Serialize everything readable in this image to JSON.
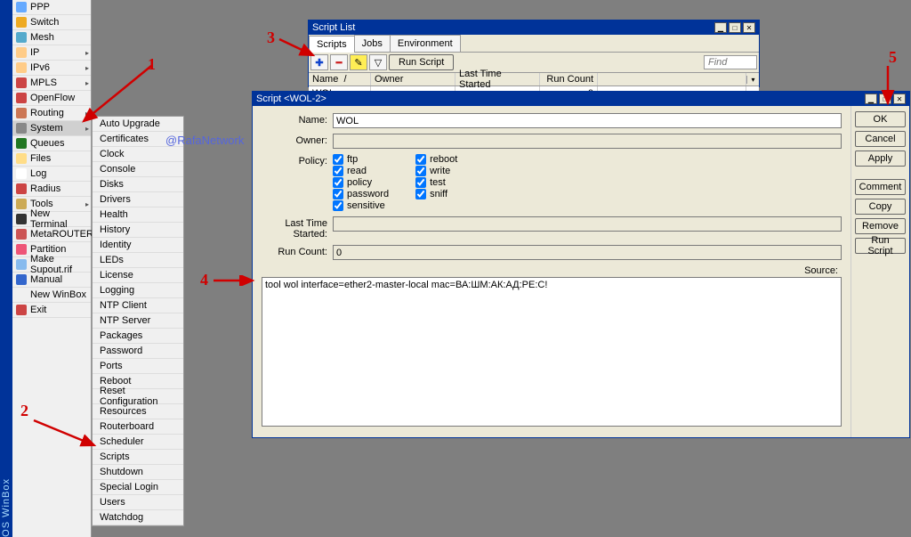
{
  "app": {
    "vertical_label": "OS  WinBox"
  },
  "watermark": "@RafaNetwork",
  "annotations": {
    "n1": "1",
    "n2": "2",
    "n3": "3",
    "n4": "4",
    "n5": "5"
  },
  "menu": [
    {
      "label": "PPP",
      "icon": "#66aaff",
      "arrow": false
    },
    {
      "label": "Switch",
      "icon": "#eeaa22",
      "arrow": false
    },
    {
      "label": "Mesh",
      "icon": "#55aacc",
      "arrow": false
    },
    {
      "label": "IP",
      "icon": "#ffcc88",
      "arrow": true
    },
    {
      "label": "IPv6",
      "icon": "#ffcc88",
      "arrow": true
    },
    {
      "label": "MPLS",
      "icon": "#cc4444",
      "arrow": true
    },
    {
      "label": "OpenFlow",
      "icon": "#cc4444",
      "arrow": false
    },
    {
      "label": "Routing",
      "icon": "#cc7755",
      "arrow": true
    },
    {
      "label": "System",
      "icon": "#888888",
      "arrow": true,
      "selected": true
    },
    {
      "label": "Queues",
      "icon": "#227722",
      "arrow": false
    },
    {
      "label": "Files",
      "icon": "#ffdd88",
      "arrow": false
    },
    {
      "label": "Log",
      "icon": "#ffffff",
      "arrow": false
    },
    {
      "label": "Radius",
      "icon": "#cc4444",
      "arrow": false
    },
    {
      "label": "Tools",
      "icon": "#ccaa55",
      "arrow": true
    },
    {
      "label": "New Terminal",
      "icon": "#333333",
      "arrow": false
    },
    {
      "label": "MetaROUTER",
      "icon": "#cc5555",
      "arrow": false
    },
    {
      "label": "Partition",
      "icon": "#ee5577",
      "arrow": false
    },
    {
      "label": "Make Supout.rif",
      "icon": "#88bbee",
      "arrow": false
    },
    {
      "label": "Manual",
      "icon": "#3366cc",
      "arrow": false
    },
    {
      "label": "New WinBox",
      "icon": "",
      "arrow": false
    },
    {
      "label": "Exit",
      "icon": "#cc4444",
      "arrow": false
    }
  ],
  "submenu": [
    "Auto Upgrade",
    "Certificates",
    "Clock",
    "Console",
    "Disks",
    "Drivers",
    "Health",
    "History",
    "Identity",
    "LEDs",
    "License",
    "Logging",
    "NTP Client",
    "NTP Server",
    "Packages",
    "Password",
    "Ports",
    "Reboot",
    "Reset Configuration",
    "Resources",
    "Routerboard",
    "Scheduler",
    "Scripts",
    "Shutdown",
    "Special Login",
    "Users",
    "Watchdog"
  ],
  "script_list": {
    "title": "Script List",
    "tabs": [
      "Scripts",
      "Jobs",
      "Environment"
    ],
    "run_button": "Run Script",
    "find_placeholder": "Find",
    "columns": [
      "Name",
      "Owner",
      "Last Time Started",
      "Run Count"
    ],
    "triangle": "▾",
    "sort_sep": "/",
    "rows": [
      {
        "name": "WOL",
        "owner": "",
        "last": "",
        "run": "0"
      }
    ]
  },
  "script_edit": {
    "title": "Script <WOL-2>",
    "labels": {
      "name": "Name:",
      "owner": "Owner:",
      "policy": "Policy:",
      "last": "Last Time Started:",
      "run": "Run Count:",
      "source": "Source:"
    },
    "name_value": "WOL",
    "owner_value": "",
    "run_count": "0",
    "last_started": "",
    "policies_col1": [
      {
        "label": "ftp",
        "checked": true
      },
      {
        "label": "read",
        "checked": true
      },
      {
        "label": "policy",
        "checked": true
      },
      {
        "label": "password",
        "checked": true
      },
      {
        "label": "sensitive",
        "checked": true
      }
    ],
    "policies_col2": [
      {
        "label": "reboot",
        "checked": true
      },
      {
        "label": "write",
        "checked": true
      },
      {
        "label": "test",
        "checked": true
      },
      {
        "label": "sniff",
        "checked": true
      }
    ],
    "source": "tool wol interface=ether2-master-local mac=ВА:ШМ:АК:АД:РЕ:С!",
    "buttons": [
      "OK",
      "Cancel",
      "Apply",
      "Comment",
      "Copy",
      "Remove",
      "Run Script"
    ]
  }
}
